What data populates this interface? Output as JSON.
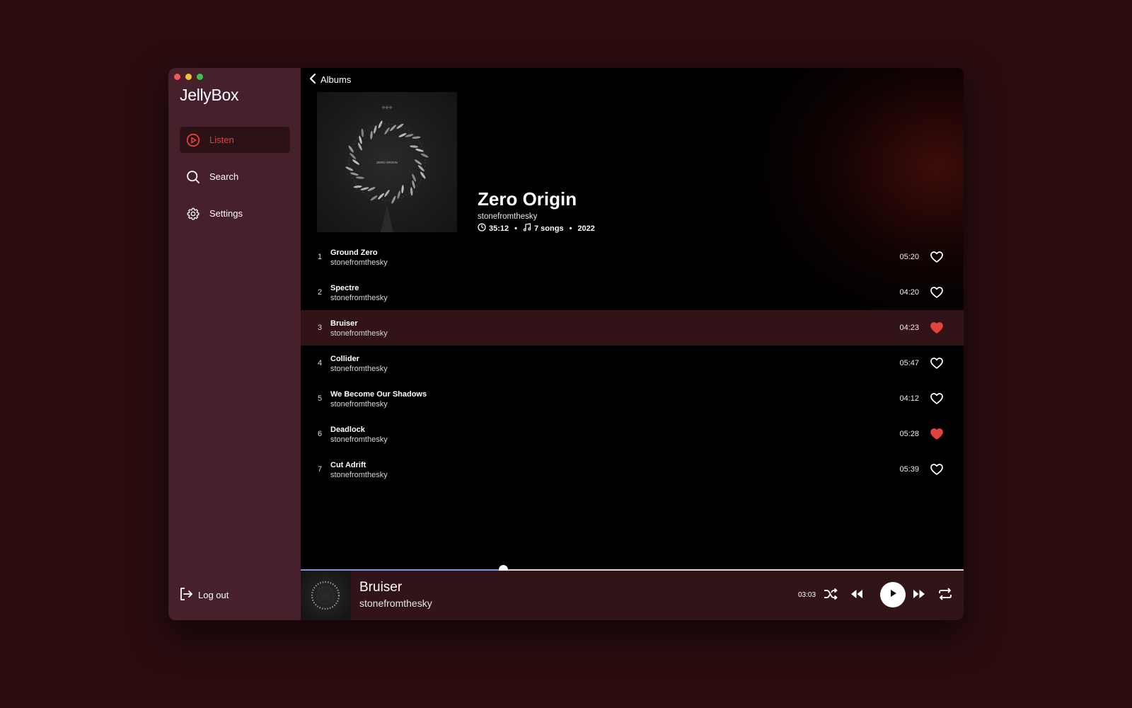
{
  "window": {
    "controls": [
      "close",
      "minimize",
      "zoom"
    ]
  },
  "sidebar": {
    "app_title": "JellyBox",
    "items": [
      {
        "label": "Listen",
        "icon": "play-circle-icon",
        "active": true
      },
      {
        "label": "Search",
        "icon": "search-icon",
        "active": false
      },
      {
        "label": "Settings",
        "icon": "gear-icon",
        "active": false
      }
    ],
    "logout_label": "Log out"
  },
  "header": {
    "back_label": "Albums"
  },
  "album": {
    "title": "Zero Origin",
    "artist": "stonefromthesky",
    "duration": "35:12",
    "song_count": "7 songs",
    "year": "2022",
    "cover_text": "ZERO ORIGIN"
  },
  "tracks": [
    {
      "num": "1",
      "title": "Ground Zero",
      "artist": "stonefromthesky",
      "duration": "05:20",
      "liked": false,
      "playing": false
    },
    {
      "num": "2",
      "title": "Spectre",
      "artist": "stonefromthesky",
      "duration": "04:20",
      "liked": false,
      "playing": false
    },
    {
      "num": "3",
      "title": "Bruiser",
      "artist": "stonefromthesky",
      "duration": "04:23",
      "liked": true,
      "playing": true
    },
    {
      "num": "4",
      "title": "Collider",
      "artist": "stonefromthesky",
      "duration": "05:47",
      "liked": false,
      "playing": false
    },
    {
      "num": "5",
      "title": "We Become Our Shadows",
      "artist": "stonefromthesky",
      "duration": "04:12",
      "liked": false,
      "playing": false
    },
    {
      "num": "6",
      "title": "Deadlock",
      "artist": "stonefromthesky",
      "duration": "05:28",
      "liked": true,
      "playing": false
    },
    {
      "num": "7",
      "title": "Cut Adrift",
      "artist": "stonefromthesky",
      "duration": "05:39",
      "liked": false,
      "playing": false
    }
  ],
  "player": {
    "title": "Bruiser",
    "artist": "stonefromthesky",
    "elapsed": "03:03",
    "progress_fraction": 0.305
  },
  "colors": {
    "accent": "#e2433e",
    "sidebar_bg": "#46202a",
    "page_bg": "#2a0c0f",
    "progress_fill": "#7e93e0"
  }
}
